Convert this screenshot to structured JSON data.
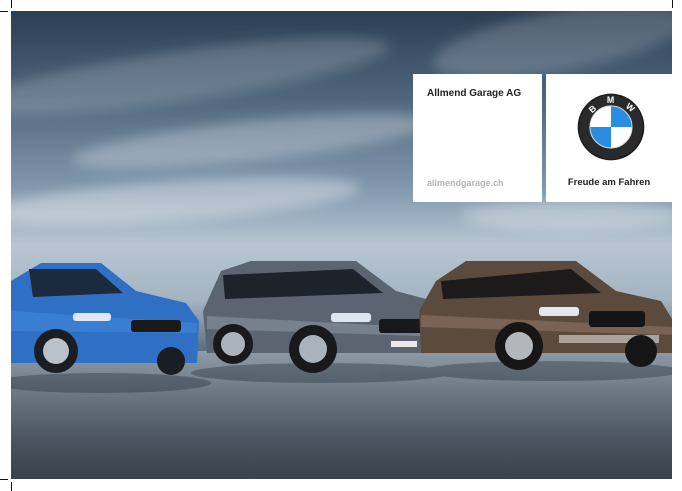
{
  "dealer": {
    "name": "Allmend Garage AG",
    "url": "allmendgarage.ch"
  },
  "brand": {
    "logo_letters": "BMW",
    "slogan": "Freude am Fahren"
  },
  "scene": {
    "description_icon": "bmw-cars-photo",
    "colors": {
      "sky_dark": "#2b3e52",
      "sky_light": "#b7c6d2",
      "car_blue": "#2f6fc4",
      "car_grey": "#5b6470",
      "car_bronze": "#5c4a3c",
      "logo_blue": "#2a8ee0"
    }
  }
}
